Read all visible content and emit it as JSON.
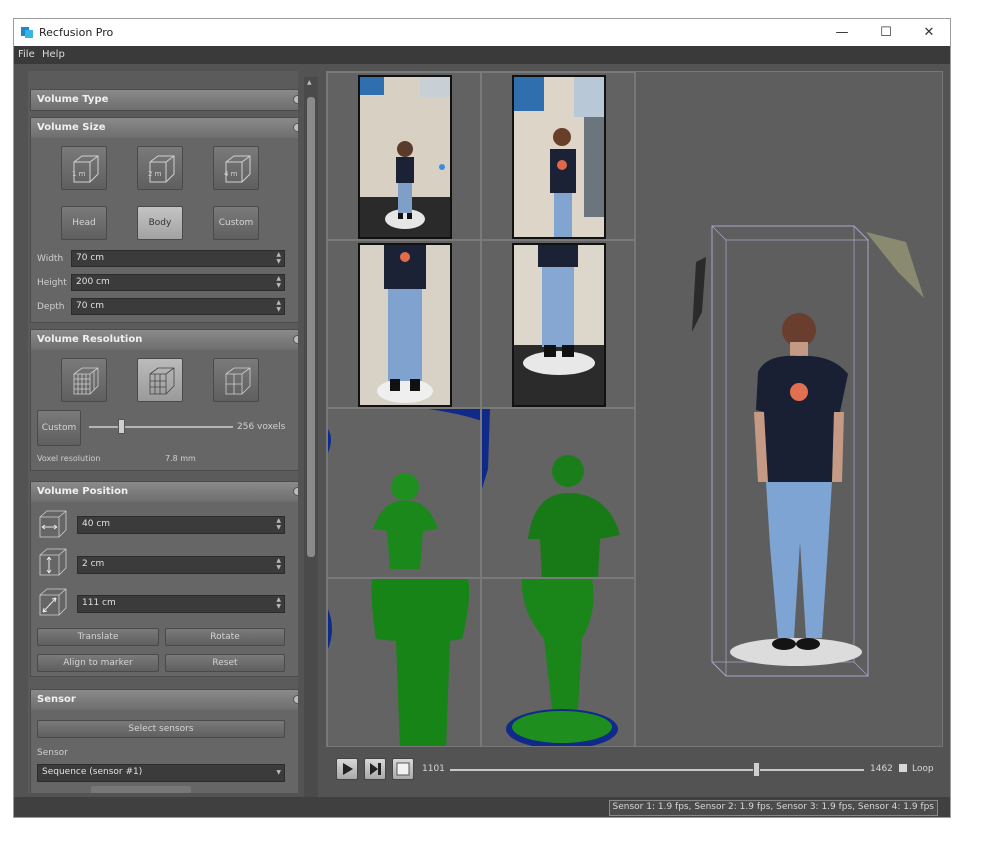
{
  "window": {
    "title": "Recfusion Pro",
    "minimize": "—",
    "maximize": "☐",
    "close": "✕"
  },
  "menu": [
    {
      "label": "File"
    },
    {
      "label": "Help"
    }
  ],
  "volume_type": {
    "title": "Volume Type"
  },
  "volume_size": {
    "title": "Volume Size",
    "cube_buttons": [
      "1 m",
      "2 m",
      "4 m"
    ],
    "preset_buttons": [
      "Head",
      "Body",
      "Custom"
    ],
    "active_preset": "Body",
    "fields": [
      {
        "label": "Width",
        "value": "70 cm"
      },
      {
        "label": "Height",
        "value": "200 cm"
      },
      {
        "label": "Depth",
        "value": "70 cm"
      }
    ]
  },
  "volume_resolution": {
    "title": "Volume Resolution",
    "custom_label": "Custom",
    "slider_value_label": "256 voxels",
    "slider_fraction": 0.22,
    "voxel_label": "Voxel resolution",
    "voxel_value": "7.8 mm"
  },
  "volume_position": {
    "title": "Volume Position",
    "fields": [
      "40 cm",
      "2 cm",
      "111 cm"
    ],
    "buttons": [
      "Translate",
      "Rotate",
      "Align to marker",
      "Reset"
    ]
  },
  "sensor": {
    "title": "Sensor",
    "select_button": "Select sensors",
    "sensor_label": "Sensor",
    "sensor_value": "Sequence (sensor #1)"
  },
  "playback": {
    "start_frame": "1101",
    "end_frame": "1462",
    "position_fraction": 0.74,
    "loop_label": "Loop"
  },
  "status": {
    "text": "Sensor 1: 1.9 fps, Sensor 2: 1.9 fps, Sensor 3: 1.9 fps, Sensor 4: 1.9 fps"
  },
  "colors": {
    "panel": "#666666",
    "depth_green": "#1f8a1f",
    "mask_blue": "#102a8a",
    "accent": "#1e88c8"
  }
}
